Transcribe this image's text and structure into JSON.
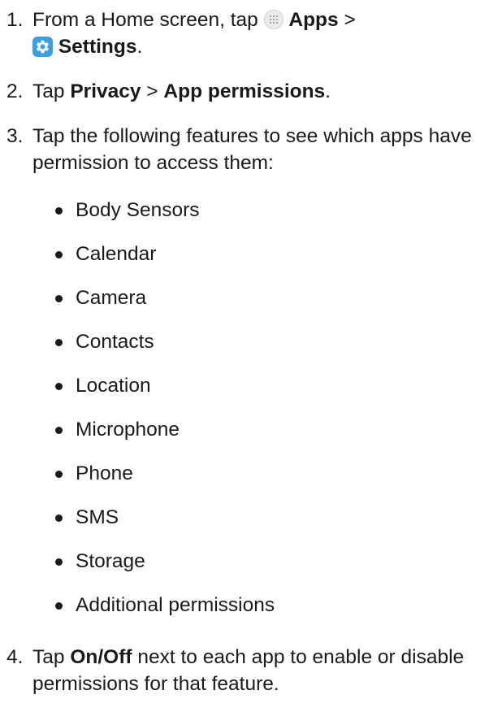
{
  "steps": [
    {
      "num": "1.",
      "text_a": "From a Home screen, tap ",
      "icon_apps": "apps-icon",
      "bold_apps": "Apps",
      "sep": " >",
      "icon_settings": "settings-icon",
      "bold_settings": "Settings",
      "end": "."
    },
    {
      "num": "2.",
      "text_a": "Tap ",
      "bold_privacy": "Privacy",
      "sep": " > ",
      "bold_perm": "App permissions",
      "end": "."
    },
    {
      "num": "3.",
      "text": "Tap the following features to see which apps have permission to access them:"
    },
    {
      "num": "4.",
      "text_a": "Tap ",
      "bold_onoff": "On/Off",
      "text_b": " next to each app to enable or disable permissions for that feature."
    }
  ],
  "features": [
    "Body Sensors",
    "Calendar",
    "Camera",
    "Contacts",
    "Location",
    "Microphone",
    "Phone",
    "SMS",
    "Storage",
    "Additional permissions"
  ],
  "colors": {
    "text": "#1a1a1a",
    "settings_icon_bg": "#3aa0e3",
    "apps_icon_bg": "#ececec"
  }
}
